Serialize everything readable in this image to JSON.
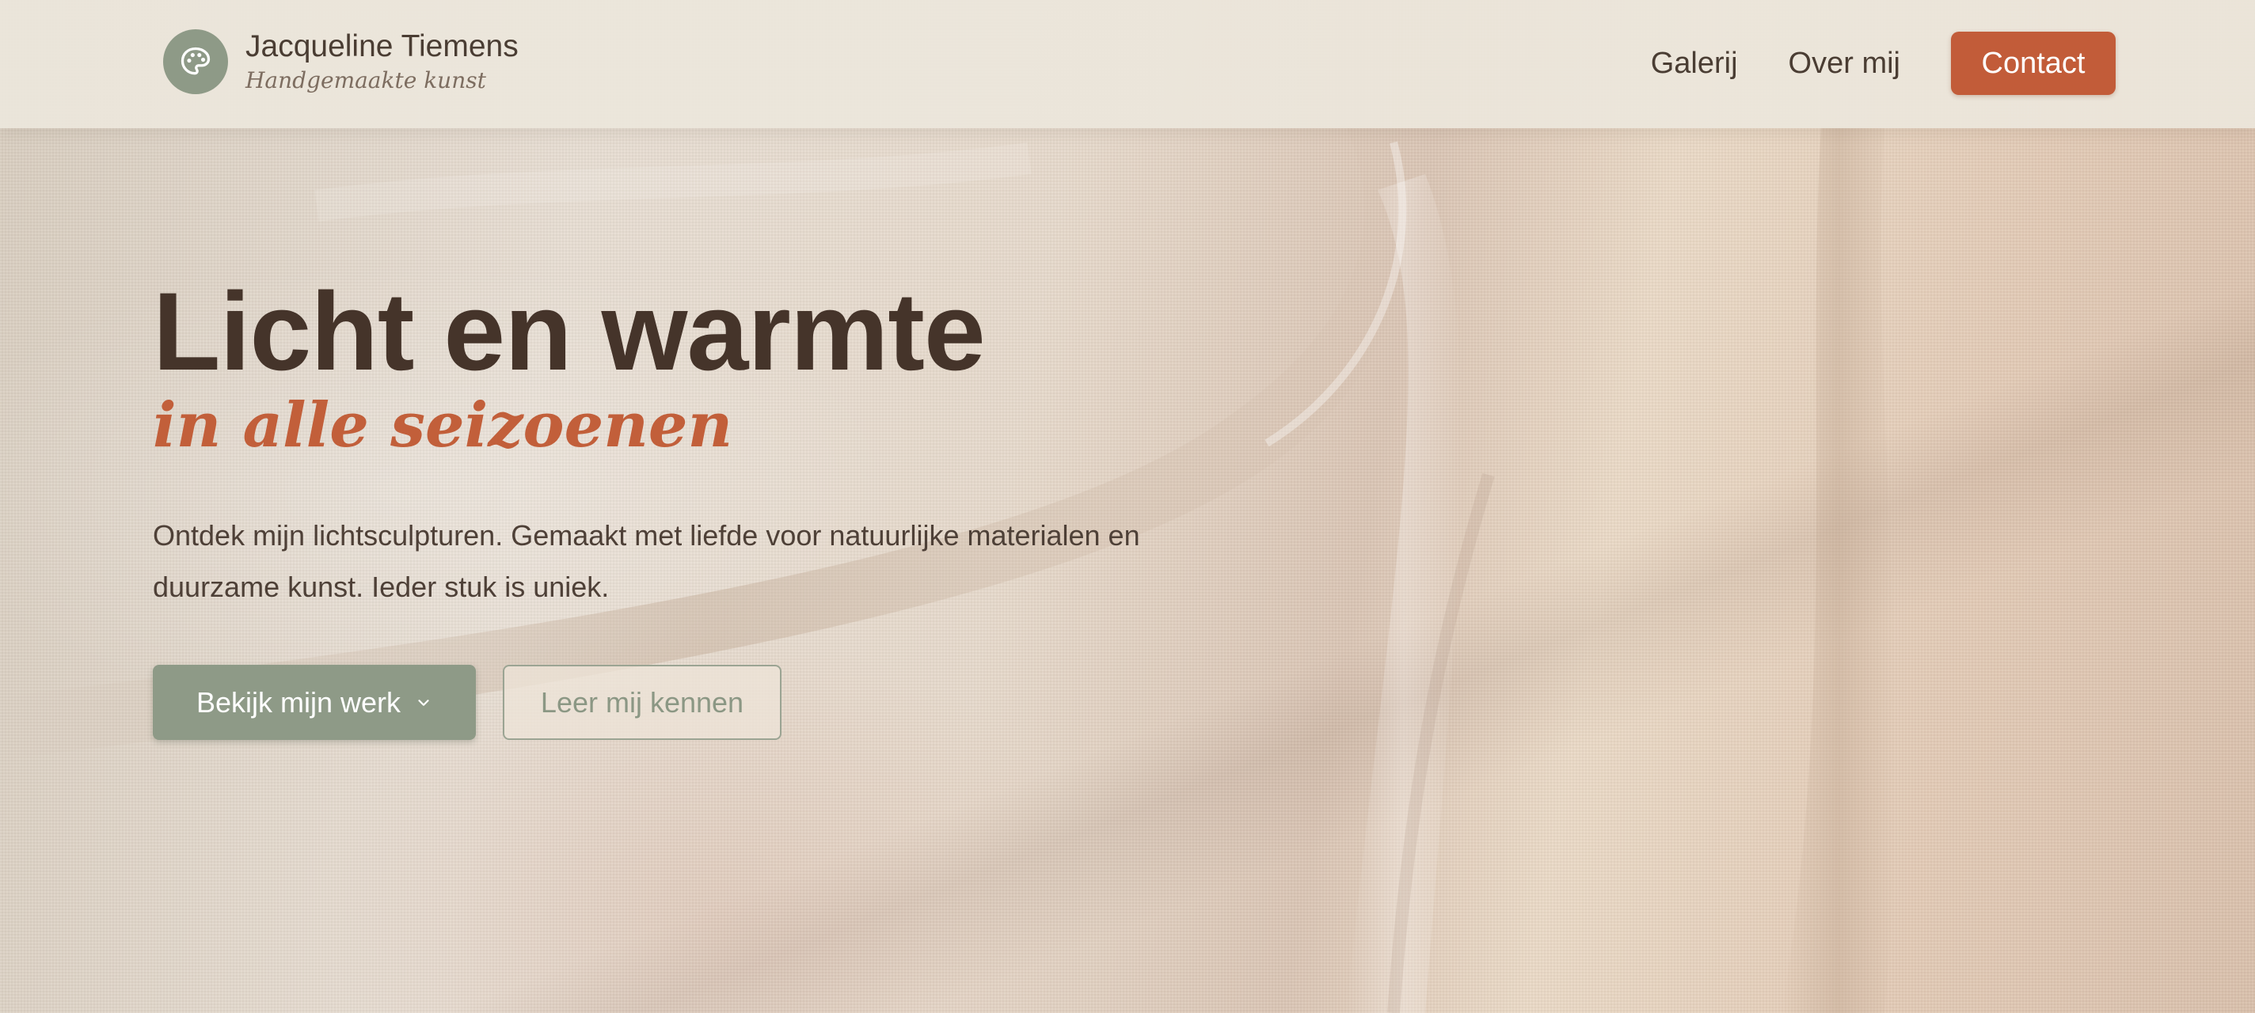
{
  "brand": {
    "name": "Jacqueline Tiemens",
    "tagline": "Handgemaakte kunst",
    "icon": "palette-icon"
  },
  "nav": {
    "links": [
      "Galerij",
      "Over mij"
    ],
    "cta": "Contact"
  },
  "hero": {
    "title": "Licht en warmte",
    "subtitle": "in alle seizoenen",
    "description": "Ontdek mijn lichtsculpturen. Gemaakt met liefde voor natuurlijke materialen en duurzame kunst. Ieder stuk is uniek.",
    "primary_button": "Bekijk mijn werk",
    "secondary_button": "Leer mij kennen"
  },
  "colors": {
    "accent": "#c25c39",
    "sage": "#8e9a87",
    "text_dark": "#45342a",
    "header_bg": "#ece6dc"
  }
}
